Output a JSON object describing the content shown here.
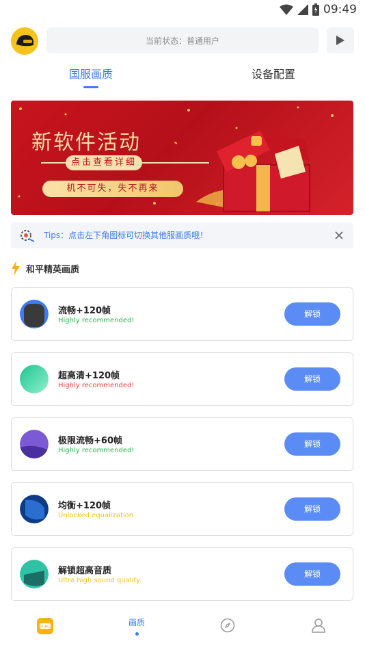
{
  "status_bar": {
    "time": "09:49"
  },
  "header": {
    "status_text": "当前状态：普通用户"
  },
  "tabs": [
    {
      "label": "国服画质",
      "active": true
    },
    {
      "label": "设备配置",
      "active": false
    }
  ],
  "banner": {
    "title": "新软件活动",
    "detail_label": "点击查看详细",
    "slogan": "机不可失，失不再来"
  },
  "tips": {
    "text": "Tips：点击左下角图标可切换其他服画质哦！"
  },
  "section": {
    "title": "和平精英画质"
  },
  "items": [
    {
      "title": "流畅+120帧",
      "subtitle": "Highly recommended!",
      "subtitle_color": "#2bb34b",
      "button": "解锁",
      "icon_color": "#3a3a3a",
      "ring_color": "#3b7cf7"
    },
    {
      "title": "超高清+120帧",
      "subtitle": "Highly recommended!",
      "subtitle_color": "#e8403a",
      "button": "解锁",
      "icon_color": "#34d1a1",
      "ring_color": "#5fe0b6"
    },
    {
      "title": "极限流畅+60帧",
      "subtitle": "Highly recommended!",
      "subtitle_color": "#2bb34b",
      "button": "解锁",
      "icon_color": "#5b3fb8",
      "ring_color": "#7c5ad6"
    },
    {
      "title": "均衡+120帧",
      "subtitle": "Unlocked equalization",
      "subtitle_color": "#f0c419",
      "button": "解锁",
      "icon_color": "#1d5fb8",
      "ring_color": "#0e3b88"
    },
    {
      "title": "解锁超高音质",
      "subtitle": "Ultra high sound quality",
      "subtitle_color": "#f0c419",
      "button": "解锁",
      "icon_color": "#1f8f86",
      "ring_color": "#2fc3a6"
    }
  ],
  "bottom_nav": [
    {
      "icon": "pubg-icon",
      "label": ""
    },
    {
      "icon": "",
      "label": "画质",
      "active": true
    },
    {
      "icon": "compass-icon",
      "label": ""
    },
    {
      "icon": "user-icon",
      "label": ""
    }
  ],
  "colors": {
    "accent": "#3b7cf7",
    "button": "#5b8cf5",
    "banner": "#c8141e"
  }
}
